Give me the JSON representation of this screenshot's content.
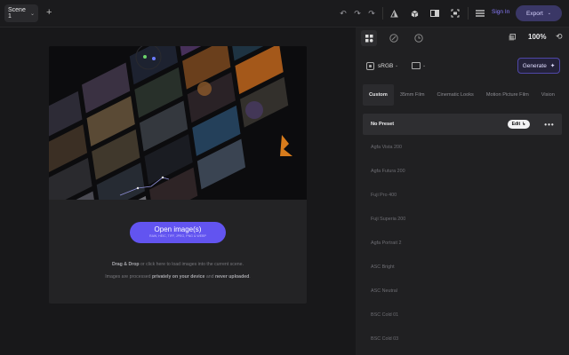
{
  "topbar": {
    "scene_tab": "Scene 1",
    "add_icon": "plus-icon",
    "icons": [
      "undo-icon",
      "redo-icon",
      "redo-arrow-icon",
      "compare-triangle-icon",
      "cube-icon",
      "split-view-icon",
      "fit-screen-icon",
      "menu-icon"
    ],
    "signin": "Sign In",
    "export": "Export"
  },
  "canvas": {
    "open_button": "Open image(s)",
    "open_sub": "RAW, HEIC, TIFF, JPEG, PNG & WEBP",
    "drop_hint_bold": "Drag & Drop",
    "drop_hint_rest": " or click here to load images into the current scene.",
    "privacy_prefix": "Images are processed ",
    "privacy_bold1": "privately on your device",
    "privacy_mid": " and ",
    "privacy_bold2": "never uploaded",
    "privacy_suffix": "."
  },
  "panel": {
    "zoom": "100%",
    "color_space": "sRGB",
    "generate": "Generate",
    "tabs": [
      "Custom",
      "35mm Film",
      "Cinematic Looks",
      "Motion Picture Film",
      "Vision"
    ],
    "active_preset": "No Preset",
    "edit": "Edit",
    "presets": [
      "Agfa Vista 200",
      "Agfa Futura 200",
      "Fuji Pro 400",
      "Fuji Superia 200",
      "Agfa Portrait 2",
      "ASC Bright",
      "ASC Neutral",
      "BSC Cold 01",
      "BSC Cold 03"
    ]
  },
  "colors": {
    "accent": "#6254f0",
    "signin": "#8b7dff",
    "background": "#18181a",
    "panel": "#202022"
  }
}
